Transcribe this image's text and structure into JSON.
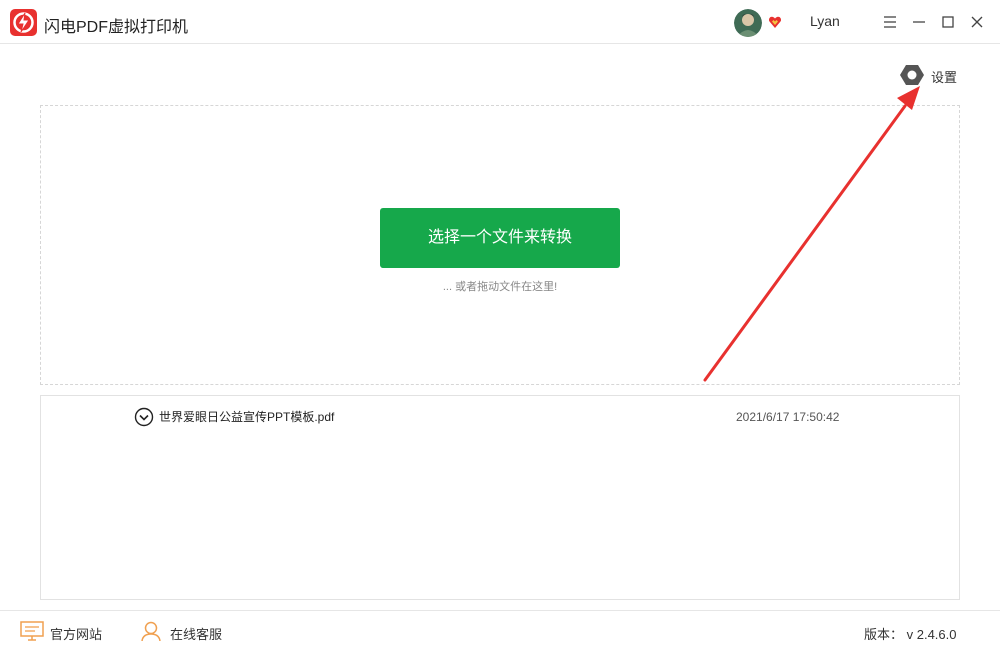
{
  "app": {
    "title": "闪电PDF虚拟打印机",
    "accent_color": "#16a84b",
    "logo_color": "#e8312f"
  },
  "header": {
    "username": "Lyan",
    "icons": [
      "avatar",
      "vip-heart-icon",
      "menu-icon",
      "minimize-icon",
      "maximize-icon",
      "close-icon"
    ]
  },
  "settings": {
    "label": "设置",
    "icon": "gear-icon"
  },
  "dropzone": {
    "button_label": "选择一个文件来转换",
    "hint": "... 或者拖动文件在这里!"
  },
  "files": [
    {
      "name": "世界爱眼日公益宣传PPT模板.pdf",
      "time": "2021/6/17 17:50:42",
      "icon": "chevron-down-circle-icon"
    }
  ],
  "footer": {
    "website_label": "官方网站",
    "support_label": "在线客服",
    "version": "版本： v 2.4.6.0",
    "annotation_arrow_color": "#e8312f"
  }
}
